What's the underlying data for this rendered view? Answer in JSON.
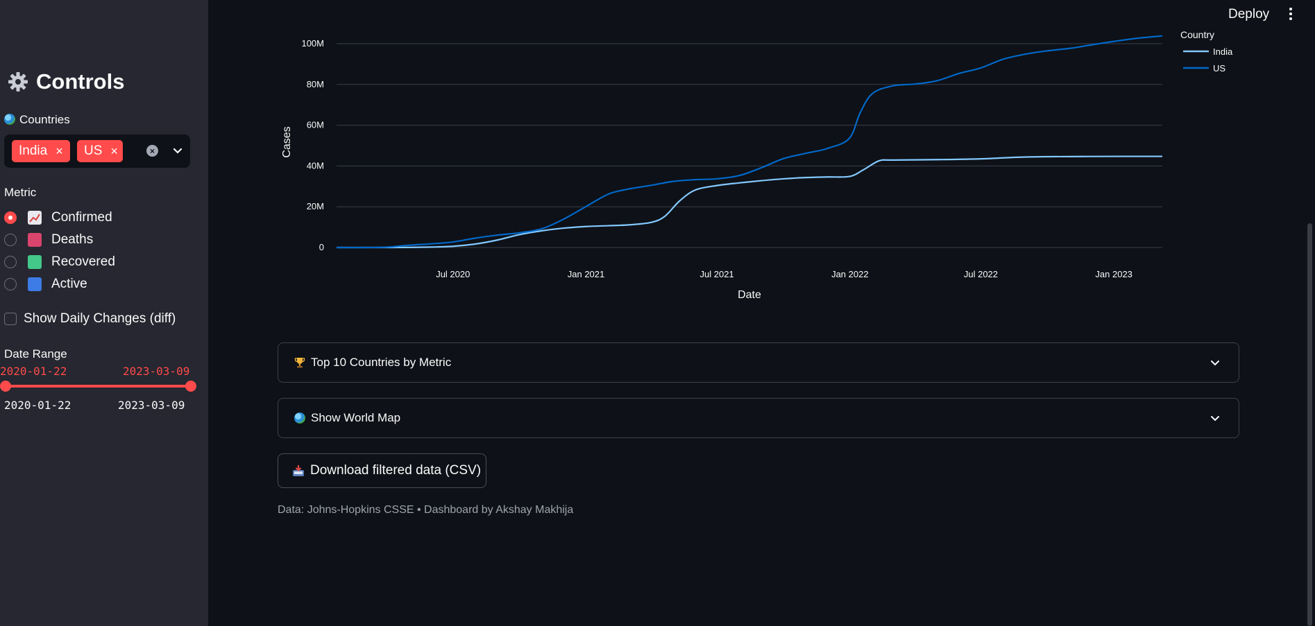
{
  "header": {
    "deploy_label": "Deploy"
  },
  "sidebar": {
    "title": "Controls",
    "countries_label": "Countries",
    "selected_countries": [
      "India",
      "US"
    ],
    "metric_label": "Metric",
    "metrics": [
      {
        "label": "Confirmed",
        "selected": true,
        "icon": "chart-increasing-icon"
      },
      {
        "label": "Deaths",
        "selected": false,
        "icon": "red-square-icon"
      },
      {
        "label": "Recovered",
        "selected": false,
        "icon": "green-square-icon"
      },
      {
        "label": "Active",
        "selected": false,
        "icon": "blue-square-icon"
      }
    ],
    "diff_label": "Show Daily Changes (diff)",
    "diff_checked": false,
    "date_range_label": "Date Range",
    "date_start": "2020-01-22",
    "date_end": "2023-03-09",
    "range_min": "2020-01-22",
    "range_max": "2023-03-09"
  },
  "chart_data": {
    "type": "line",
    "xlabel": "Date",
    "ylabel": "Cases",
    "legend_title": "Country",
    "legend_position": "top-right",
    "grid": true,
    "x_ticks": [
      "Jul 2020",
      "Jan 2021",
      "Jul 2021",
      "Jan 2022",
      "Jul 2022",
      "Jan 2023"
    ],
    "y_ticks": [
      "0",
      "20M",
      "40M",
      "60M",
      "80M",
      "100M"
    ],
    "ylim": [
      0,
      100000000
    ],
    "xlim": [
      "2020-01-22",
      "2023-03-09"
    ],
    "series": [
      {
        "name": "India",
        "color": "#83c9ff",
        "points": [
          [
            "2020-01-22",
            0
          ],
          [
            "2020-03-01",
            0
          ],
          [
            "2020-05-01",
            40000
          ],
          [
            "2020-06-01",
            200000
          ],
          [
            "2020-07-01",
            600000
          ],
          [
            "2020-08-01",
            1700000
          ],
          [
            "2020-09-01",
            3700000
          ],
          [
            "2020-10-01",
            6300000
          ],
          [
            "2020-11-01",
            8200000
          ],
          [
            "2020-12-01",
            9500000
          ],
          [
            "2021-01-01",
            10300000
          ],
          [
            "2021-02-01",
            10700000
          ],
          [
            "2021-03-01",
            11100000
          ],
          [
            "2021-04-01",
            12300000
          ],
          [
            "2021-04-20",
            15300000
          ],
          [
            "2021-05-10",
            22700000
          ],
          [
            "2021-06-01",
            28200000
          ],
          [
            "2021-07-01",
            30400000
          ],
          [
            "2021-08-01",
            31700000
          ],
          [
            "2021-09-01",
            32800000
          ],
          [
            "2021-10-01",
            33700000
          ],
          [
            "2021-11-01",
            34300000
          ],
          [
            "2021-12-01",
            34600000
          ],
          [
            "2022-01-01",
            34900000
          ],
          [
            "2022-01-20",
            38200000
          ],
          [
            "2022-02-10",
            42500000
          ],
          [
            "2022-03-01",
            42900000
          ],
          [
            "2022-05-01",
            43100000
          ],
          [
            "2022-07-01",
            43500000
          ],
          [
            "2022-09-01",
            44400000
          ],
          [
            "2022-12-01",
            44670000
          ],
          [
            "2023-03-09",
            44700000
          ]
        ]
      },
      {
        "name": "US",
        "color": "#0068c9",
        "points": [
          [
            "2020-01-22",
            0
          ],
          [
            "2020-03-01",
            100
          ],
          [
            "2020-04-01",
            200000
          ],
          [
            "2020-05-01",
            1100000
          ],
          [
            "2020-06-01",
            1800000
          ],
          [
            "2020-07-01",
            2700000
          ],
          [
            "2020-08-01",
            4600000
          ],
          [
            "2020-09-01",
            6100000
          ],
          [
            "2020-10-01",
            7200000
          ],
          [
            "2020-11-01",
            9200000
          ],
          [
            "2020-12-01",
            13900000
          ],
          [
            "2021-01-01",
            20100000
          ],
          [
            "2021-02-01",
            26200000
          ],
          [
            "2021-03-01",
            28700000
          ],
          [
            "2021-04-01",
            30500000
          ],
          [
            "2021-05-01",
            32400000
          ],
          [
            "2021-06-01",
            33300000
          ],
          [
            "2021-07-01",
            33700000
          ],
          [
            "2021-08-01",
            35300000
          ],
          [
            "2021-09-01",
            39200000
          ],
          [
            "2021-10-01",
            43600000
          ],
          [
            "2021-11-01",
            46200000
          ],
          [
            "2021-12-01",
            48600000
          ],
          [
            "2021-12-31",
            53500000
          ],
          [
            "2022-01-15",
            66000000
          ],
          [
            "2022-02-01",
            75500000
          ],
          [
            "2022-03-01",
            79300000
          ],
          [
            "2022-04-01",
            80200000
          ],
          [
            "2022-05-01",
            81800000
          ],
          [
            "2022-06-01",
            85400000
          ],
          [
            "2022-07-01",
            88100000
          ],
          [
            "2022-08-01",
            92400000
          ],
          [
            "2022-09-01",
            94900000
          ],
          [
            "2022-10-01",
            96500000
          ],
          [
            "2022-11-01",
            97700000
          ],
          [
            "2022-12-01",
            99400000
          ],
          [
            "2023-01-01",
            101100000
          ],
          [
            "2023-02-01",
            102600000
          ],
          [
            "2023-03-09",
            103800000
          ]
        ]
      }
    ]
  },
  "expanders": [
    {
      "label": "Top 10 Countries by Metric",
      "icon": "trophy-icon"
    },
    {
      "label": "Show World Map",
      "icon": "globe-icon"
    }
  ],
  "download_label": "Download filtered data (CSV)",
  "caption": "Data: Johns-Hopkins CSSE • Dashboard by Akshay Makhija"
}
